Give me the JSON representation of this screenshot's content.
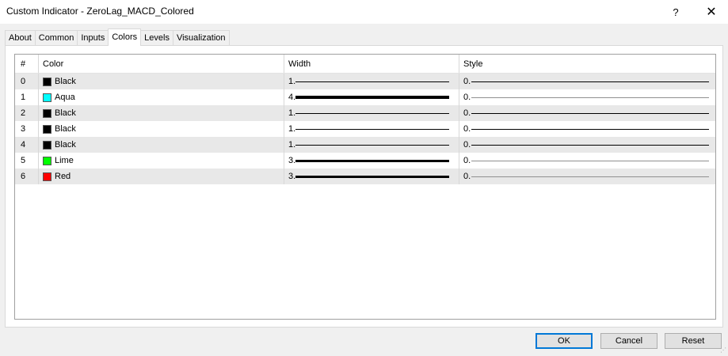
{
  "window": {
    "title": "Custom Indicator - ZeroLag_MACD_Colored",
    "help_glyph": "?",
    "close_glyph": "✕"
  },
  "tabs": [
    {
      "label": "About",
      "active": false
    },
    {
      "label": "Common",
      "active": false
    },
    {
      "label": "Inputs",
      "active": false
    },
    {
      "label": "Colors",
      "active": true
    },
    {
      "label": "Levels",
      "active": false
    },
    {
      "label": "Visualization",
      "active": false
    }
  ],
  "table": {
    "columns": [
      "#",
      "Color",
      "Width",
      "Style"
    ],
    "rows": [
      {
        "index": "0",
        "color_name": "Black",
        "swatch": "#000000",
        "width_label": "1.",
        "width_value": 1,
        "style_label": "0.",
        "style_value": 0
      },
      {
        "index": "1",
        "color_name": "Aqua",
        "swatch": "#00ffff",
        "width_label": "4.",
        "width_value": 4,
        "style_label": "0.",
        "style_value": 0
      },
      {
        "index": "2",
        "color_name": "Black",
        "swatch": "#000000",
        "width_label": "1.",
        "width_value": 1,
        "style_label": "0.",
        "style_value": 0
      },
      {
        "index": "3",
        "color_name": "Black",
        "swatch": "#000000",
        "width_label": "1.",
        "width_value": 1,
        "style_label": "0.",
        "style_value": 0
      },
      {
        "index": "4",
        "color_name": "Black",
        "swatch": "#000000",
        "width_label": "1.",
        "width_value": 1,
        "style_label": "0.",
        "style_value": 0
      },
      {
        "index": "5",
        "color_name": "Lime",
        "swatch": "#00ff00",
        "width_label": "3.",
        "width_value": 3,
        "style_label": "0.",
        "style_value": 0
      },
      {
        "index": "6",
        "color_name": "Red",
        "swatch": "#ff0000",
        "width_label": "3.",
        "width_value": 3,
        "style_label": "0.",
        "style_value": 0
      }
    ]
  },
  "buttons": {
    "ok": "OK",
    "cancel": "Cancel",
    "reset": "Reset"
  },
  "colors": {
    "accent": "#0078d7",
    "row_shade": "#e8e8e8"
  }
}
